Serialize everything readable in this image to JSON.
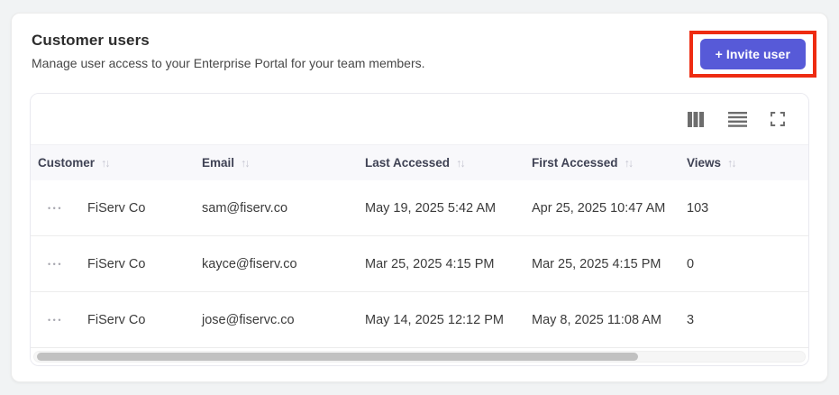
{
  "panel": {
    "title": "Customer users",
    "subtitle": "Manage user access to your Enterprise Portal for your team members.",
    "invite_button_label": "+ Invite user"
  },
  "colors": {
    "accent": "#575ad8",
    "annotation": "#ee2c12",
    "header_bg": "#f8f8fb",
    "header_text": "#3f4254"
  },
  "toolbar": {
    "icons": [
      "columns-view",
      "row-density",
      "fullscreen"
    ]
  },
  "table": {
    "sort_glyph": "↑↓",
    "actions_glyph": "•••",
    "columns": [
      "Customer",
      "Email",
      "Last Accessed",
      "First Accessed",
      "Views"
    ],
    "rows": [
      {
        "customer": "FiServ Co",
        "email": "sam@fiserv.co",
        "last_accessed": "May 19, 2025 5:42 AM",
        "first_accessed": "Apr 25, 2025 10:47 AM",
        "views": "103"
      },
      {
        "customer": "FiServ Co",
        "email": "kayce@fiserv.co",
        "last_accessed": "Mar 25, 2025 4:15 PM",
        "first_accessed": "Mar 25, 2025 4:15 PM",
        "views": "0"
      },
      {
        "customer": "FiServ Co",
        "email": "jose@fiservc.co",
        "last_accessed": "May 14, 2025 12:12 PM",
        "first_accessed": "May 8, 2025 11:08 AM",
        "views": "3"
      }
    ],
    "scroll": {
      "thumb_fraction": 0.78
    }
  }
}
